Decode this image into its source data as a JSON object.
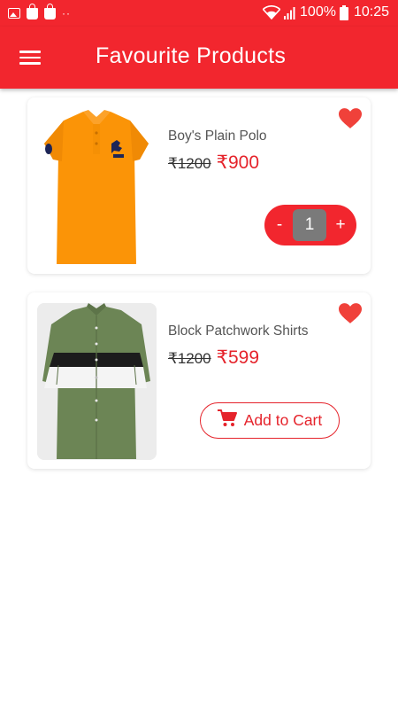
{
  "status_bar": {
    "battery_text": "100%",
    "time": "10:25",
    "left_icons": [
      "image-icon",
      "shopping-bag-icon",
      "shopping-bag-icon",
      "more-dots-icon"
    ],
    "right_icons": [
      "wifi-icon",
      "signal-icon",
      "battery-icon"
    ]
  },
  "app_bar": {
    "title": "Favourite Products",
    "menu_icon": "hamburger-menu-icon"
  },
  "colors": {
    "primary": "#f2262e",
    "price": "#e5232b",
    "quantity_box": "#7a7a7a"
  },
  "products": [
    {
      "name": "Boy's Plain Polo",
      "old_price": "₹1200",
      "new_price": "₹900",
      "favourite": true,
      "quantity": "1",
      "minus_label": "-",
      "plus_label": "+"
    },
    {
      "name": "Block Patchwork Shirts",
      "old_price": "₹1200",
      "new_price": "₹599",
      "favourite": true,
      "cart_label": "Add to Cart",
      "cart_icon": "shopping-cart-icon"
    }
  ]
}
